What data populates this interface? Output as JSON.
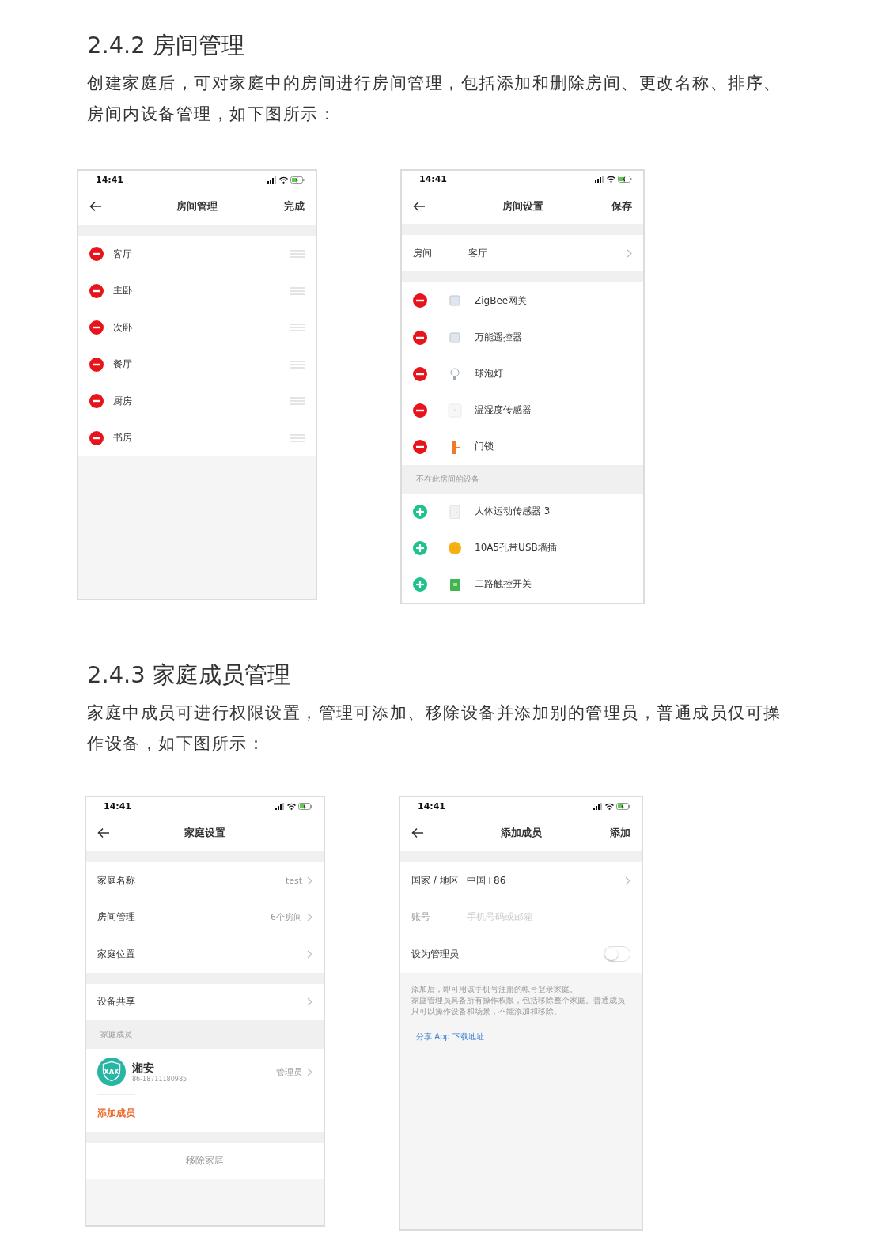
{
  "sections": [
    {
      "heading": "2.4.2 房间管理",
      "paragraph": "创建家庭后，可对家庭中的房间进行房间管理，包括添加和删除房间、更改名称、排序、房间内设备管理，如下图所示：",
      "phones": [
        {
          "time": "14:41",
          "title": "房间管理",
          "action": "完成",
          "blocks": [
            {
              "kind": "gap"
            },
            {
              "kind": "room",
              "label": "客厅"
            },
            {
              "kind": "room",
              "label": "主卧"
            },
            {
              "kind": "room",
              "label": "次卧"
            },
            {
              "kind": "room",
              "label": "餐厅"
            },
            {
              "kind": "room",
              "label": "厨房"
            },
            {
              "kind": "room",
              "label": "书房"
            }
          ]
        },
        {
          "time": "14:41",
          "title": "房间设置",
          "action": "保存",
          "blocks": [
            {
              "kind": "gap"
            },
            {
              "kind": "field",
              "label": "房间",
              "value": "客厅"
            },
            {
              "kind": "gap"
            },
            {
              "kind": "removable_device",
              "label": "ZigBee网关"
            },
            {
              "kind": "removable_device",
              "label": "万能遥控器"
            },
            {
              "kind": "removable_device",
              "label": "球泡灯"
            },
            {
              "kind": "removable_device",
              "label": "温湿度传感器"
            },
            {
              "kind": "removable_device",
              "label": "门锁"
            },
            {
              "kind": "header",
              "text": "不在此房间的设备"
            },
            {
              "kind": "addable_device",
              "label": "人体运动传感器 3"
            },
            {
              "kind": "addable_device",
              "label": "10A5孔带USB墙插"
            },
            {
              "kind": "addable_device",
              "label": "二路触控开关"
            }
          ]
        }
      ]
    },
    {
      "heading": "2.4.3 家庭成员管理",
      "paragraph": "家庭中成员可进行权限设置，管理可添加、移除设备并添加别的管理员，普通成员仅可操作设备，如下图所示：",
      "phones": [
        {
          "time": "14:41",
          "title": "家庭设置",
          "blocks": [
            {
              "kind": "gap"
            },
            {
              "kind": "setting",
              "label": "家庭名称",
              "value": "test"
            },
            {
              "kind": "setting",
              "label": "房间管理",
              "value": "6个房间"
            },
            {
              "kind": "setting",
              "label": "家庭位置"
            },
            {
              "kind": "gap"
            },
            {
              "kind": "setting",
              "label": "设备共享"
            },
            {
              "kind": "header",
              "text": "家庭成员"
            },
            {
              "kind": "member",
              "name": "湘安",
              "sub": "86-18711180985",
              "avatar_text": "XAK",
              "role": "管理员"
            },
            {
              "kind": "action",
              "text": "添加成员"
            },
            {
              "kind": "gap"
            },
            {
              "kind": "center",
              "text": "移除家庭"
            }
          ]
        },
        {
          "time": "14:41",
          "title": "添加成员",
          "action": "添加",
          "blocks": [
            {
              "kind": "gap"
            },
            {
              "kind": "field",
              "label": "国家 / 地区",
              "value": "中国+86"
            },
            {
              "kind": "input",
              "label": "账号",
              "placeholder": "手机号码或邮箱"
            },
            {
              "kind": "toggle",
              "label": "设为管理员",
              "on": false
            },
            {
              "kind": "note",
              "lines": [
                "添加后，即可用该手机号注册的帐号登录家庭。",
                "家庭管理员具备所有操作权限，包括移除整个家庭。普通成员只可以操作设备和场景，不能添加和移除。"
              ],
              "link": "分享 App 下载地址"
            }
          ]
        }
      ]
    }
  ]
}
